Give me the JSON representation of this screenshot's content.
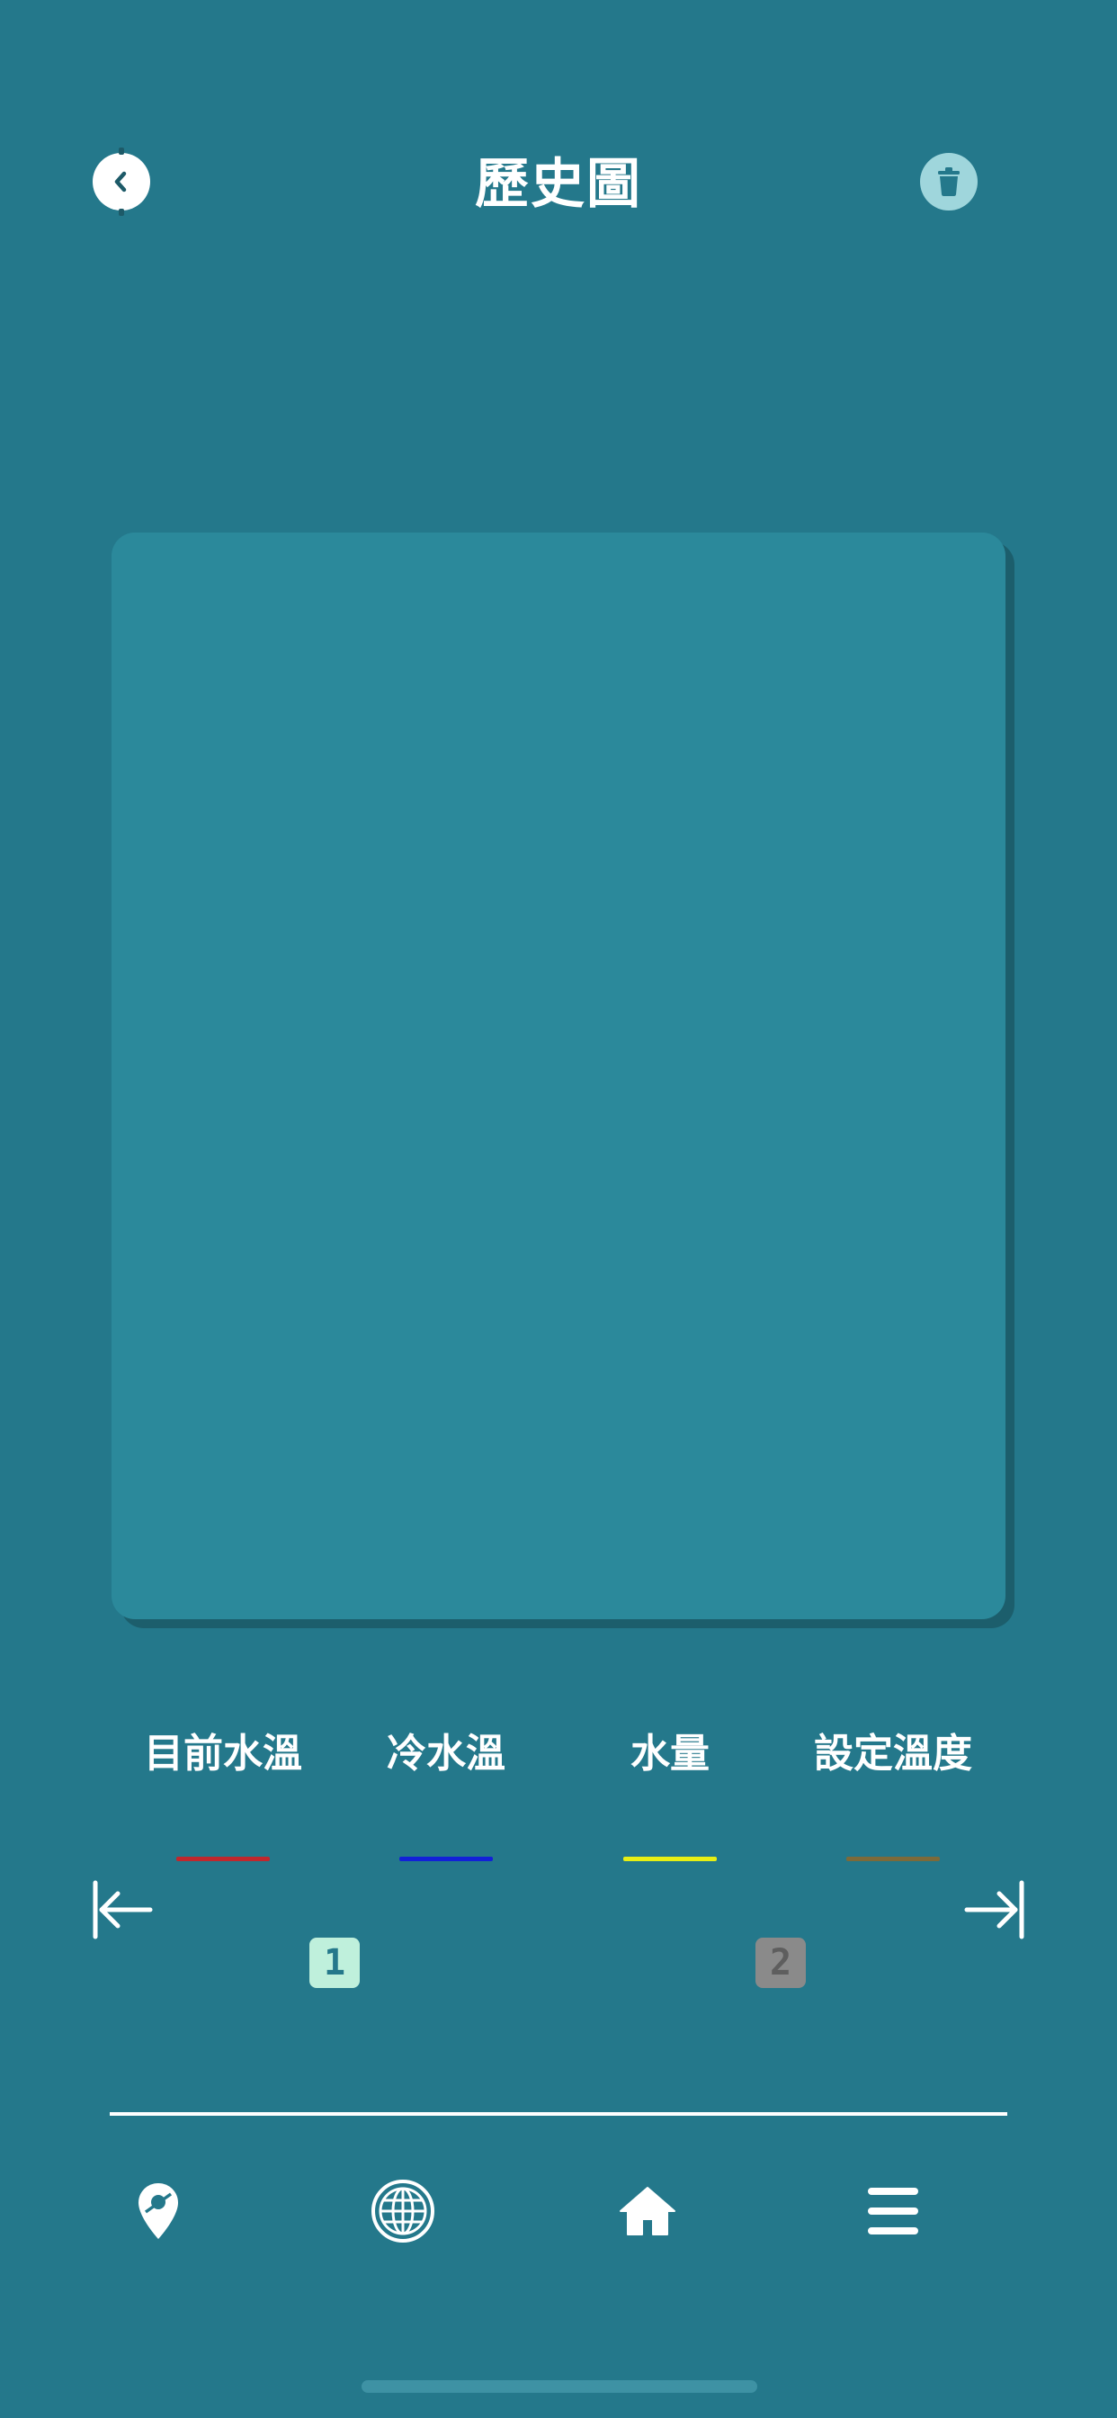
{
  "header": {
    "title": "歷史圖",
    "back_icon": "chevron-left-icon",
    "delete_icon": "trash-icon"
  },
  "legend": [
    {
      "label": "目前水溫",
      "color": "#c0272d"
    },
    {
      "label": "冷水溫",
      "color": "#1220d8"
    },
    {
      "label": "水量",
      "color": "#e7ef14"
    },
    {
      "label": "設定溫度",
      "color": "#7c6a3a"
    }
  ],
  "pagination": {
    "first_icon": "arrow-left-to-bar-icon",
    "last_icon": "arrow-right-to-bar-icon",
    "pages": [
      {
        "label": "1",
        "active": true
      },
      {
        "label": "2",
        "active": false
      }
    ],
    "active_color": "#bff0dc",
    "inactive_color": "#8a8a8a"
  },
  "bottom_nav": [
    {
      "name": "location",
      "icon": "map-pin-icon"
    },
    {
      "name": "globe",
      "icon": "globe-icon"
    },
    {
      "name": "home",
      "icon": "home-icon"
    },
    {
      "name": "menu",
      "icon": "hamburger-menu-icon"
    }
  ],
  "colors": {
    "background": "#24788b",
    "chart_card": "#2b899b",
    "trash_button": "#9fd6dc"
  }
}
